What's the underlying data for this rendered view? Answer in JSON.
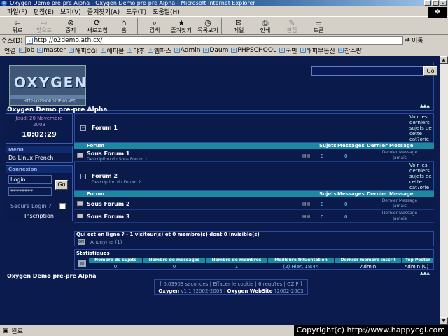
{
  "window": {
    "title": "Oxygen Demo pre-pre Alpha - Oxygen Demo pre-pre Alpha - Microsoft Internet Explorer",
    "btn_min": "_",
    "btn_max": "□",
    "btn_close": "×"
  },
  "menubar": [
    "파일(F)",
    "편집(E)",
    "보기(V)",
    "즐겨찾기(A)",
    "도구(T)",
    "도움말(H)"
  ],
  "toolbar": {
    "back": "뒤로",
    "forward": "앞으로",
    "stop": "중지",
    "refresh": "새로고침",
    "home": "홈",
    "search": "검색",
    "favorites": "즐겨찾기",
    "history": "목록보기",
    "mail": "메일",
    "print": "인쇄",
    "edit": "편집",
    "discuss": "토론"
  },
  "address": {
    "label": "주소(D)",
    "url": "http://o2demo.ath.cx/",
    "go": "이동"
  },
  "links": {
    "label": "연결",
    "items": [
      "job",
      "master",
      "해피CGI",
      "해피몰",
      "야후",
      "엠파스",
      "Admin",
      "Daum",
      "PHPSCHOOL",
      "국민",
      "해피부동산",
      "잡수량"
    ]
  },
  "page": {
    "logo_text": "OXYGEN",
    "logo_url": "HTTP://O2SHOP.O2DEMO.NET/",
    "search_go": "Go",
    "site_name": "Oxygen Demo pre-pre Alpha",
    "header_arrows": "▲▲▲",
    "date_line1": "Jeudi 20 Novembre",
    "date_line2": "2003",
    "time": "10:02:29",
    "menu_head": "Menu",
    "menu_item": "Da Linux French",
    "login_head": "Connexion",
    "login_placeholder": "Login",
    "password_value": "********",
    "login_go": "Go",
    "secure_label": "Secure Login ?",
    "signup": "Inscription"
  },
  "categories": [
    {
      "title": "Forum 1",
      "desc": "",
      "right": "Voir les derniers sujets de cette cat?orie",
      "forums": [
        {
          "name": "Sous Forum 1",
          "desc": "Description du Sous Forum 1",
          "sujets": "0",
          "messages": "0",
          "last": "Dernier Message",
          "last2": "Jamais"
        }
      ]
    },
    {
      "title": "Forum 2",
      "desc": "Description du Forum 2",
      "right": "Voir les derniers sujets de cette cat?orie",
      "forums": [
        {
          "name": "Sous Forum 2",
          "desc": "",
          "sujets": "0",
          "messages": "0",
          "last": "Dernier Message",
          "last2": "Jamais"
        },
        {
          "name": "Sous Forum 3",
          "desc": "",
          "sujets": "0",
          "messages": "0",
          "last": "Dernier Message",
          "last2": "Jamais"
        }
      ]
    }
  ],
  "columns": {
    "forum": "Forum",
    "sujets": "Sujets",
    "messages": "Messages",
    "last": "Dernier Message"
  },
  "online": {
    "title": "Qui est en ligne ? - 1 visiteur(s) et 0 membre(s) dont 0 invisible(s)",
    "badge": "ON",
    "anon": "Anonyme (1)"
  },
  "stats": {
    "title": "Statistiques",
    "headers": [
      "Nombre de sujets",
      "Nombre de messages",
      "Nombre de membres",
      "Meilleure fr?uentation",
      "Dernier membre inscrit",
      "Top Poster"
    ],
    "values": [
      "0",
      "0",
      "1",
      "(2) Hier, 18:44",
      "Admin",
      "Admin (0)"
    ]
  },
  "footer": {
    "site_name": "Oxygen Demo pre-pre Alpha",
    "line1": "[ 0.03903 secondes | Effacer le cookie | 6 requ?es | GZIP ]",
    "oxygen": "Oxygen",
    "line2a": " v1.1 ?2002-2003 | ",
    "website": "Oxygen WebSite",
    "line2b": " ?2002-2003"
  },
  "status": {
    "text": "완료",
    "copyright": "Copyright(c) http://www.happycgi.com"
  }
}
